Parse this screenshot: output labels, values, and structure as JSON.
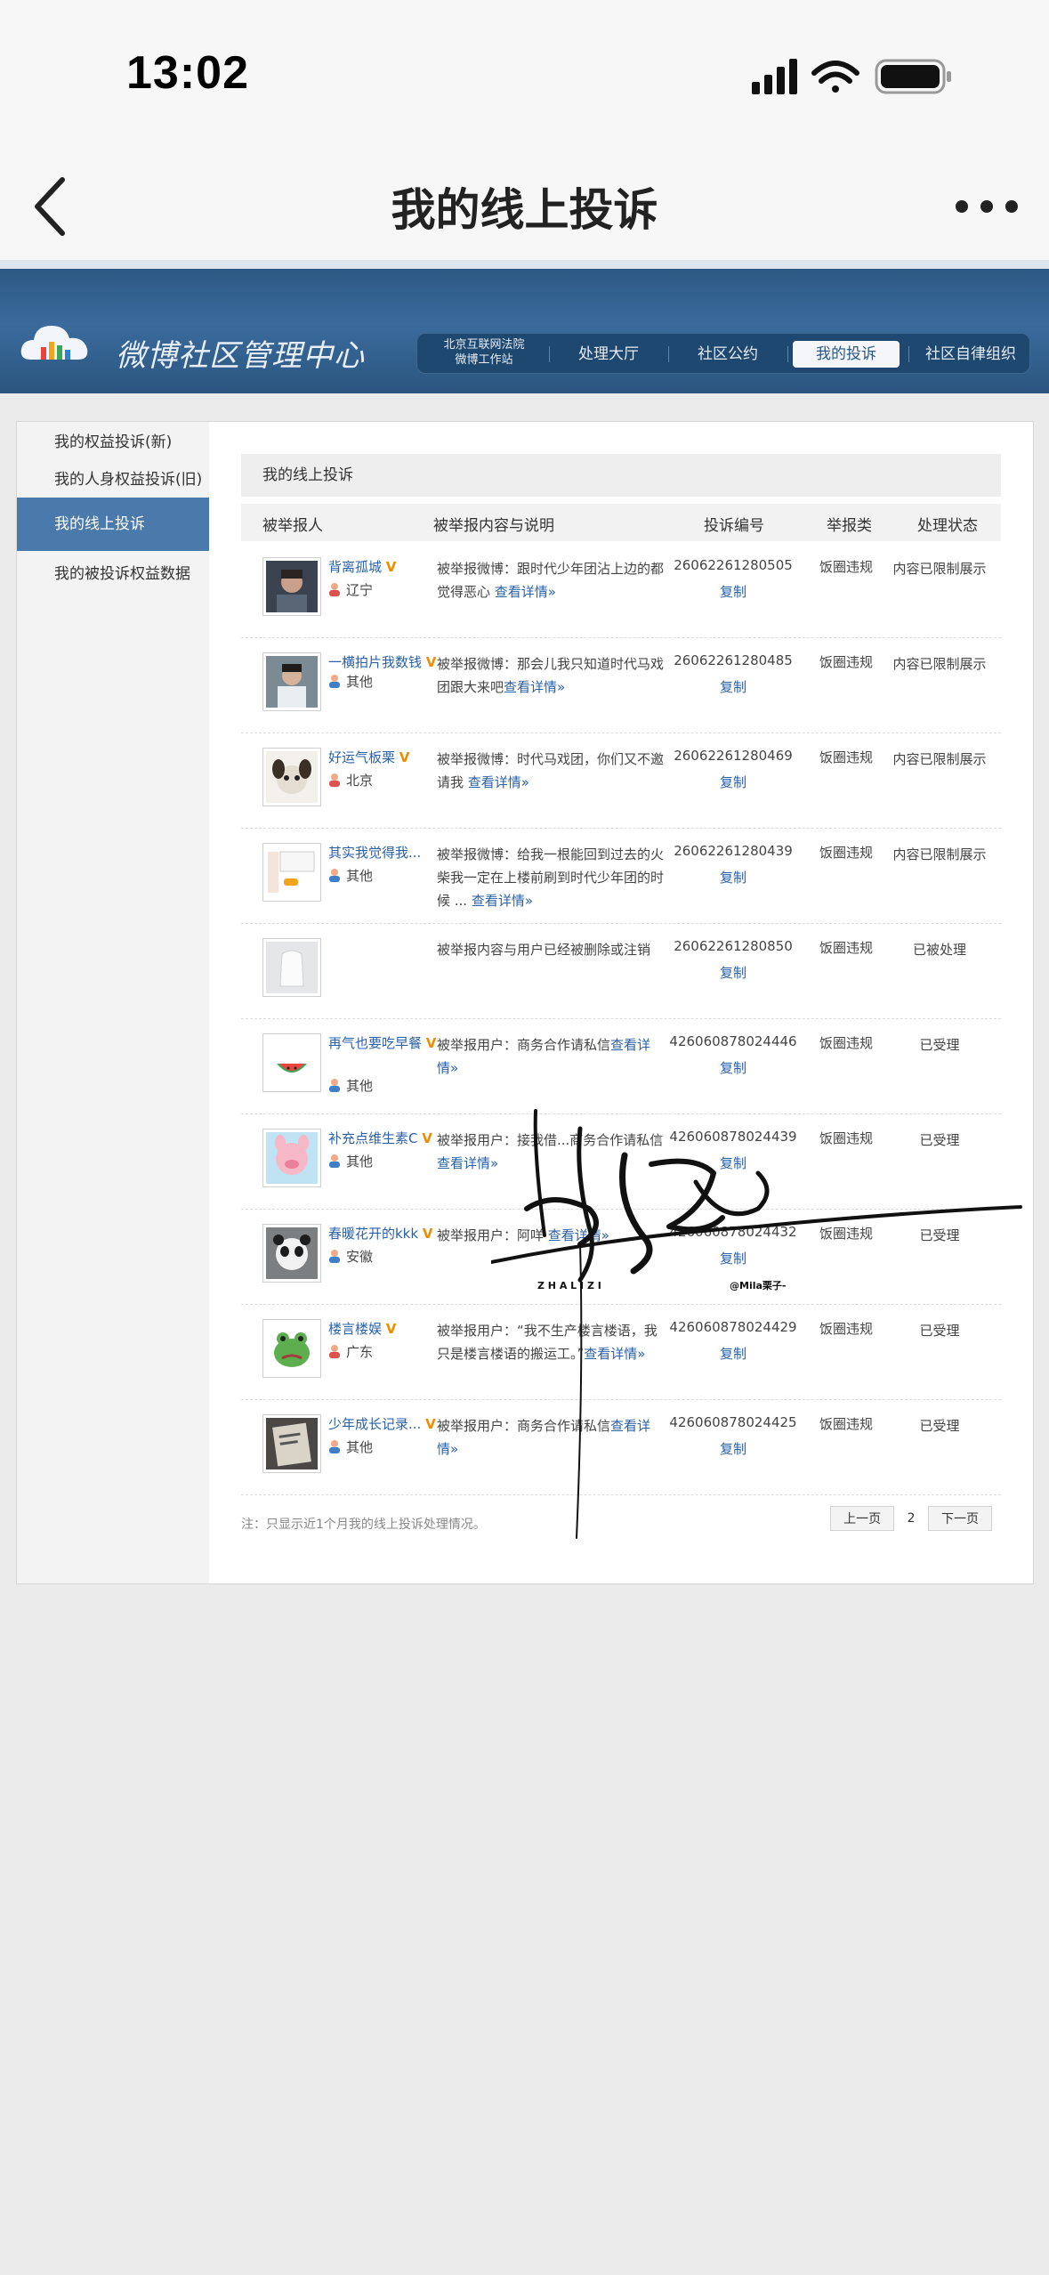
{
  "status_bar": {
    "time": "13:02"
  },
  "nav": {
    "title": "我的线上投诉"
  },
  "header": {
    "logo_text": "微博社区管理中心",
    "court_line1": "北京互联网法院",
    "court_line2": "微博工作站",
    "tabs": [
      "处理大厅",
      "社区公约",
      "我的投诉",
      "社区自律组织"
    ],
    "active_tab": "我的投诉"
  },
  "sidebar": {
    "items": [
      "我的权益投诉(新)",
      "我的人身权益投诉(旧)",
      "我的线上投诉",
      "我的被投诉权益数据"
    ],
    "active": "我的线上投诉"
  },
  "main": {
    "section_title": "我的线上投诉",
    "columns": [
      "被举报人",
      "被举报内容与说明",
      "投诉编号",
      "举报类",
      "处理状态"
    ],
    "copy_label": "复制",
    "rows": [
      {
        "name": "背离孤城",
        "location": "辽宁",
        "desc": "被举报微博：跟时代少年团沾上边的都觉得恶心",
        "link": "查看详情»",
        "id": "26062261280505",
        "type": "饭圈违规",
        "status": "内容已限制展示"
      },
      {
        "name": "一横拍片我数钱",
        "location": "其他",
        "desc": "被举报微博：那会儿我只知道时代马戏团跟大来吧",
        "link": "查看详情»",
        "id": "26062261280485",
        "type": "饭圈违规",
        "status": "内容已限制展示"
      },
      {
        "name": "好运气板栗",
        "location": "北京",
        "desc": "被举报微博：时代马戏团，你们又不邀请我",
        "link": "查看详情»",
        "id": "26062261280469",
        "type": "饭圈违规",
        "status": "内容已限制展示"
      },
      {
        "name": "其实我觉得我...",
        "location": "其他",
        "desc": "被举报微博：给我一根能回到过去的火柴我一定在上楼前刷到时代少年团的时候 ...",
        "link": "查看详情»",
        "id": "26062261280439",
        "type": "饭圈违规",
        "status": "内容已限制展示"
      },
      {
        "name": "",
        "location": "",
        "desc": "被举报内容与用户已经被删除或注销",
        "link": "",
        "id": "26062261280850",
        "type": "饭圈违规",
        "status": "已被处理"
      },
      {
        "name": "再气也要吃早餐",
        "location": "其他",
        "desc": "被举报用户：商务合作请私信",
        "link": "查看详情»",
        "id": "426060878024446",
        "type": "饭圈违规",
        "status": "已受理"
      },
      {
        "name": "补充点维生素C",
        "location": "其他",
        "desc": "被举报用户：接我借...商务合作请私信",
        "link": "查看详情»",
        "id": "426060878024439",
        "type": "饭圈违规",
        "status": "已受理"
      },
      {
        "name": "春暖花开的kkk",
        "location": "安徽",
        "desc": "被举报用户：阿咩",
        "link": "查看详情»",
        "id": "426060878024432",
        "type": "饭圈违规",
        "status": "已受理"
      },
      {
        "name": "楼言楼娱",
        "location": "广东",
        "desc": "被举报用户：“我不生产楼言楼语，我只是楼言楼语的搬运工。”",
        "link": "查看详情»",
        "id": "426060878024429",
        "type": "饭圈违规",
        "status": "已受理"
      },
      {
        "name": "少年成长记录...",
        "location": "其他",
        "desc": "被举报用户：商务合作请私信",
        "link": "查看详情»",
        "id": "426060878024425",
        "type": "饭圈违规",
        "status": "已受理"
      }
    ],
    "footer_note": "注：只显示近1个月我的线上投诉处理情况。",
    "pager": {
      "prev": "上一页",
      "current": "2",
      "next": "下一页"
    }
  },
  "watermark": {
    "letters": "Z H A L I Z I",
    "credit": "@Mila栗子-"
  },
  "colors": {
    "header_blue": "#2d5884",
    "link_blue": "#2a61a8",
    "verified_orange": "#f08c00",
    "sidebar_active": "#4a7aab"
  },
  "icons": [
    "back-arrow-icon",
    "more-dots-icon",
    "cloud-logo-icon",
    "location-person-icon",
    "verified-v-icon"
  ]
}
